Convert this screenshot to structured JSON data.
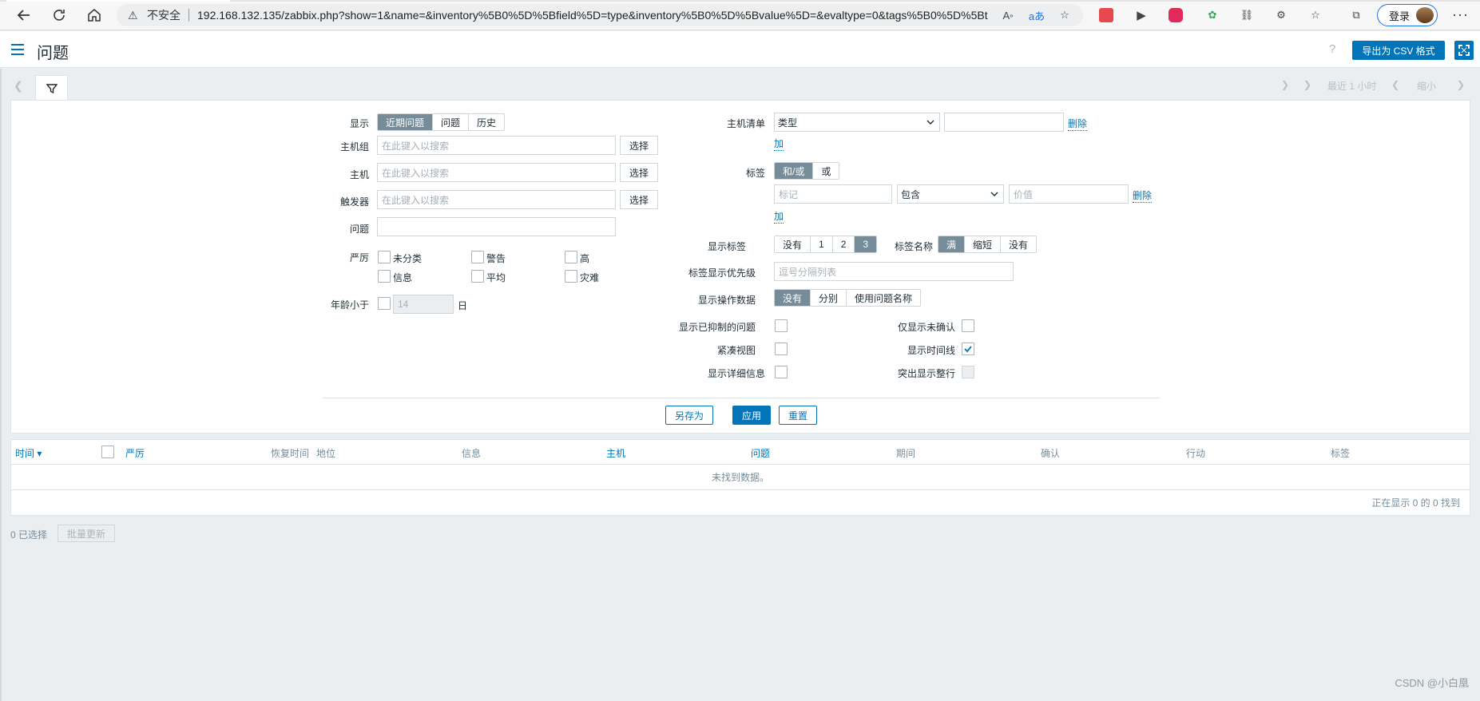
{
  "browser": {
    "insecure_label": "不安全",
    "url": "192.168.132.135/zabbix.php?show=1&name=&inventory%5B0%5D%5Bfield%5D=type&inventory%5B0%5D%5Bvalue%5D=&evaltype=0&tags%5B0%5D%5Bt...",
    "login_label": "登录"
  },
  "header": {
    "title": "问题",
    "help": "?",
    "csv_button": "导出为 CSV 格式"
  },
  "timebar": {
    "last_period": "最近 1 小时",
    "zoom_out": "缩小"
  },
  "filter": {
    "show_label": "显示",
    "show_options": [
      "近期问题",
      "问题",
      "历史"
    ],
    "show_selected": "近期问题",
    "host_groups_label": "主机组",
    "host_groups_placeholder": "在此键入以搜索",
    "hosts_label": "主机",
    "hosts_placeholder": "在此键入以搜索",
    "triggers_label": "触发器",
    "triggers_placeholder": "在此键入以搜索",
    "select_button": "选择",
    "problem_label": "问题",
    "problem_value": "",
    "severity_label": "严厉",
    "severities": [
      "未分类",
      "警告",
      "高",
      "信息",
      "平均",
      "灾难"
    ],
    "age_label": "年龄小于",
    "age_value": "14",
    "age_unit": "日",
    "inventory_label": "主机清单",
    "inventory_field": "类型",
    "inventory_value": "",
    "remove_link": "删除",
    "add_link": "加",
    "tags_label": "标签",
    "tags_eval_options": [
      "和/或",
      "或"
    ],
    "tags_eval_selected": "和/或",
    "tag_placeholder": "标记",
    "tag_operator": "包含",
    "tag_value_placeholder": "价值",
    "show_tags_label": "显示标签",
    "show_tags_options": [
      "没有",
      "1",
      "2",
      "3"
    ],
    "show_tags_selected": "3",
    "tag_name_label": "标签名称",
    "tag_name_options": [
      "满",
      "缩短",
      "没有"
    ],
    "tag_name_selected": "满",
    "tag_priority_label": "标签显示优先级",
    "tag_priority_placeholder": "逗号分隔列表",
    "show_operational_label": "显示操作数据",
    "show_operational_options": [
      "没有",
      "分别",
      "使用问题名称"
    ],
    "show_operational_selected": "没有",
    "show_suppressed_label": "显示已抑制的问题",
    "show_unacknowledged_label": "仅显示未确认",
    "compact_view_label": "紧凑视图",
    "show_timeline_label": "显示时间线",
    "show_timeline_checked": true,
    "show_details_label": "显示详细信息",
    "highlight_row_label": "突出显示整行",
    "save_as_button": "另存为",
    "apply_button": "应用",
    "reset_button": "重置"
  },
  "table": {
    "columns": [
      "时间 ▾",
      "严厉",
      "恢复时间",
      "地位",
      "信息",
      "主机",
      "问题",
      "期间",
      "确认",
      "行动",
      "标签"
    ],
    "empty_message": "未找到数据。",
    "paging": "正在显示 0 的 0 找到"
  },
  "footer": {
    "selected": "0 已选择",
    "mass_update": "批量更新",
    "watermark": "CSDN @小白凰"
  }
}
